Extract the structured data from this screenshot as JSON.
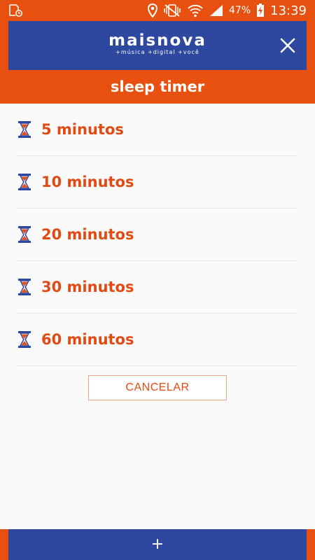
{
  "status_bar": {
    "left_icon": "storage-clock-icon",
    "icons": [
      "location-icon",
      "vibrate-icon",
      "wifi-icon",
      "signal-icon",
      "battery-charging-icon"
    ],
    "battery": "47%",
    "time": "13:39"
  },
  "header": {
    "logo": "maisnova",
    "tagline": "+música +digital +você",
    "close_icon": "close-icon"
  },
  "title": "sleep timer",
  "timers": [
    {
      "label": "5 minutos"
    },
    {
      "label": "10 minutos"
    },
    {
      "label": "20 minutos"
    },
    {
      "label": "30 minutos"
    },
    {
      "label": "60 minutos"
    }
  ],
  "cancel_label": "CANCELAR",
  "bottom_bar": {
    "plus": "+"
  },
  "colors": {
    "brand_orange": "#e8500f",
    "brand_blue": "#2e48a0",
    "text_orange": "#e24a13"
  }
}
